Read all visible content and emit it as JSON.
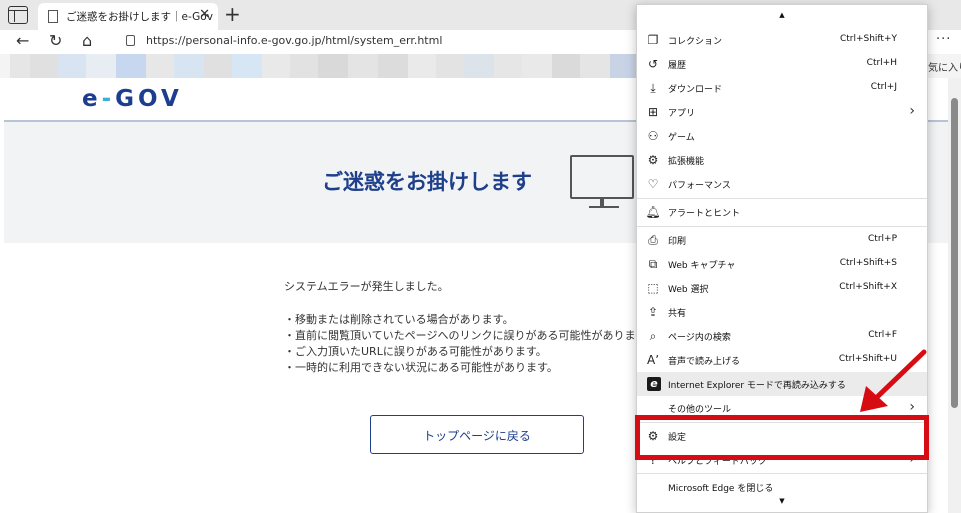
{
  "browser": {
    "tab_title": "ご迷惑をお掛けします｜e-Gov",
    "tab_close": "✕",
    "new_tab": "+",
    "url": "https://personal-info.e-gov.go.jp/html/system_err.html",
    "more": "···",
    "favorites_right": "気に入り"
  },
  "page": {
    "logo_e": "e",
    "logo_dash": "-",
    "logo_gov": "GOV",
    "title": "ご迷惑をお掛けします",
    "messages": [
      "システムエラーが発生しました。",
      "・移動または削除されている場合があります。",
      "・直前に閲覧頂いていたページへのリンクに誤りがある可能性がありま",
      "・ご入力頂いたURLに誤りがある可能性があります。",
      "・一時的に利用できない状況にある可能性があります。"
    ],
    "top_button": "トップページに戻る"
  },
  "menu": {
    "scroll_up": "▲",
    "scroll_down": "▼",
    "items": [
      {
        "label": "コレクション",
        "shortcut": "Ctrl+Shift+Y",
        "icon": "collections-icon"
      },
      {
        "label": "履歴",
        "shortcut": "Ctrl+H",
        "icon": "history-icon"
      },
      {
        "label": "ダウンロード",
        "shortcut": "Ctrl+J",
        "icon": "download-icon"
      },
      {
        "label": "アプリ",
        "shortcut": "",
        "icon": "apps-icon"
      },
      {
        "label": "ゲーム",
        "shortcut": "",
        "icon": "games-icon"
      },
      {
        "label": "拡張機能",
        "shortcut": "",
        "icon": "extensions-icon"
      },
      {
        "label": "パフォーマンス",
        "shortcut": "",
        "icon": "performance-icon"
      },
      {
        "label": "アラートとヒント",
        "shortcut": "",
        "icon": "bell-icon"
      },
      {
        "label": "印刷",
        "shortcut": "Ctrl+P",
        "icon": "print-icon"
      },
      {
        "label": "Web キャプチャ",
        "shortcut": "Ctrl+Shift+S",
        "icon": "web-capture-icon"
      },
      {
        "label": "Web 選択",
        "shortcut": "Ctrl+Shift+X",
        "icon": "web-select-icon"
      },
      {
        "label": "共有",
        "shortcut": "",
        "icon": "share-icon"
      },
      {
        "label": "ページ内の検索",
        "shortcut": "Ctrl+F",
        "icon": "find-icon"
      },
      {
        "label": "音声で読み上げる",
        "shortcut": "Ctrl+Shift+U",
        "icon": "read-aloud-icon"
      },
      {
        "label": "Internet Explorer モードで再読み込みする",
        "shortcut": "",
        "icon": "ie-icon"
      },
      {
        "label": "その他のツール",
        "shortcut": "",
        "icon": ""
      },
      {
        "label": "設定",
        "shortcut": "",
        "icon": "gear-icon"
      },
      {
        "label": "ヘルプとフィードバック",
        "shortcut": "",
        "icon": "help-icon"
      },
      {
        "label": "Microsoft Edge を閉じる",
        "shortcut": "",
        "icon": ""
      }
    ]
  },
  "colors": {
    "highlight": "#d70c13",
    "brand": "#1e3f8a",
    "accent": "#3ab0d8"
  }
}
